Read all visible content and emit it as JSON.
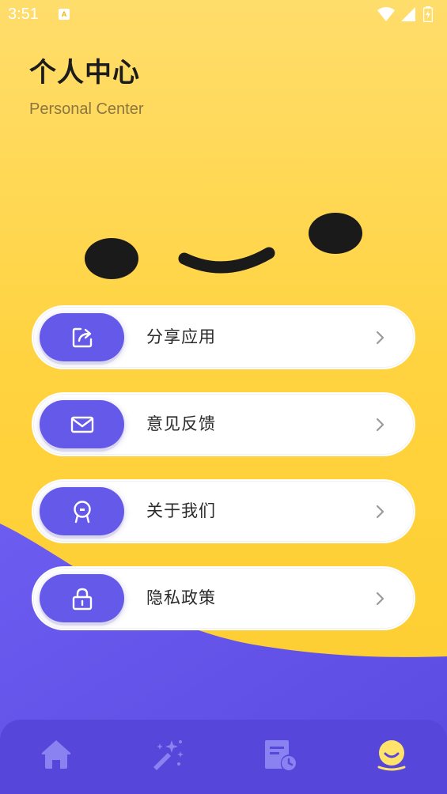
{
  "status_bar": {
    "time": "3:51",
    "notification_icon": "A",
    "icons": [
      "wifi-icon",
      "signal-icon",
      "battery-icon"
    ]
  },
  "header": {
    "title": "个人中心",
    "subtitle": "Personal Center"
  },
  "menu": {
    "items": [
      {
        "label": "分享应用",
        "icon": "share-icon"
      },
      {
        "label": "意见反馈",
        "icon": "mail-icon"
      },
      {
        "label": "关于我们",
        "icon": "face-icon"
      },
      {
        "label": "隐私政策",
        "icon": "lock-icon"
      }
    ]
  },
  "bottom_nav": {
    "items": [
      {
        "icon": "home-icon",
        "active": false
      },
      {
        "icon": "magic-wand-icon",
        "active": false
      },
      {
        "icon": "history-document-icon",
        "active": false
      },
      {
        "icon": "profile-smile-icon",
        "active": true
      }
    ]
  },
  "colors": {
    "background_yellow": "#FFD340",
    "accent_purple": "#6559E9",
    "nav_purple": "#5647DA",
    "active_nav_icon": "#FFE36A",
    "inactive_nav_icon": "#8A82F0"
  }
}
